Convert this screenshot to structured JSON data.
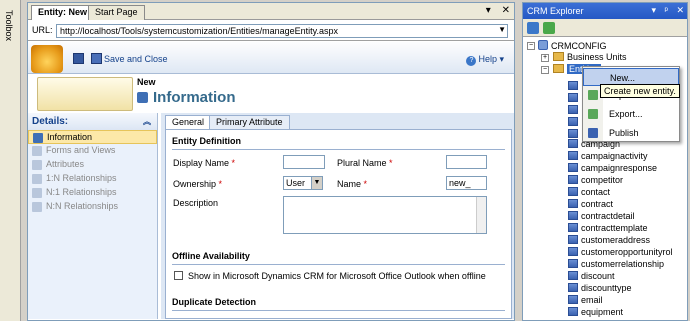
{
  "toolbox": {
    "label": "Toolbox"
  },
  "doc": {
    "tabs": [
      {
        "label": "Entity: New"
      },
      {
        "label": "Start Page"
      }
    ],
    "tab_controls": {
      "dropdown": "▾",
      "close": "✕"
    },
    "url_label": "URL:",
    "url_value": "http://localhost/Tools/systemcustomization/Entities/manageEntity.aspx"
  },
  "crm_header": {
    "save_close_label": "Save and Close",
    "help_label": "Help"
  },
  "page": {
    "new_label": "New",
    "title": "Information"
  },
  "nav": {
    "header": "Details:",
    "items": [
      {
        "label": "Information"
      },
      {
        "label": "Forms and Views"
      },
      {
        "label": "Attributes"
      },
      {
        "label": "1:N Relationships"
      },
      {
        "label": "N:1 Relationships"
      },
      {
        "label": "N:N Relationships"
      }
    ]
  },
  "form": {
    "tabs": [
      {
        "label": "General"
      },
      {
        "label": "Primary Attribute"
      }
    ],
    "entity_definition_title": "Entity Definition",
    "display_name_label": "Display Name",
    "plural_name_label": "Plural Name",
    "ownership_label": "Ownership",
    "ownership_value": "User",
    "name_label": "Name",
    "name_value": "new_",
    "description_label": "Description",
    "required_marker": "*",
    "offline_title": "Offline Availability",
    "offline_checkbox_label": "Show in Microsoft Dynamics CRM for Microsoft Office Outlook when offline",
    "duplicate_title": "Duplicate Detection"
  },
  "explorer": {
    "title": "CRM Explorer",
    "title_controls": {
      "dropdown": "▾",
      "pin": "ᵖ",
      "close": "✕"
    },
    "root": "CRMCONFIG",
    "business_units": "Business Units",
    "entities": "Entities",
    "entity_list": [
      "campaign",
      "campaignactivity",
      "campaignresponse",
      "competitor",
      "contact",
      "contract",
      "contractdetail",
      "contracttemplate",
      "customeraddress",
      "customeropportunityrol",
      "customerrelationship",
      "discount",
      "discounttype",
      "email",
      "equipment"
    ]
  },
  "context_menu": {
    "items": [
      {
        "label": "New..."
      },
      {
        "label": "Import..."
      },
      {
        "label": "Export..."
      },
      {
        "label": "Publish"
      }
    ],
    "tooltip": "Create new entity."
  }
}
